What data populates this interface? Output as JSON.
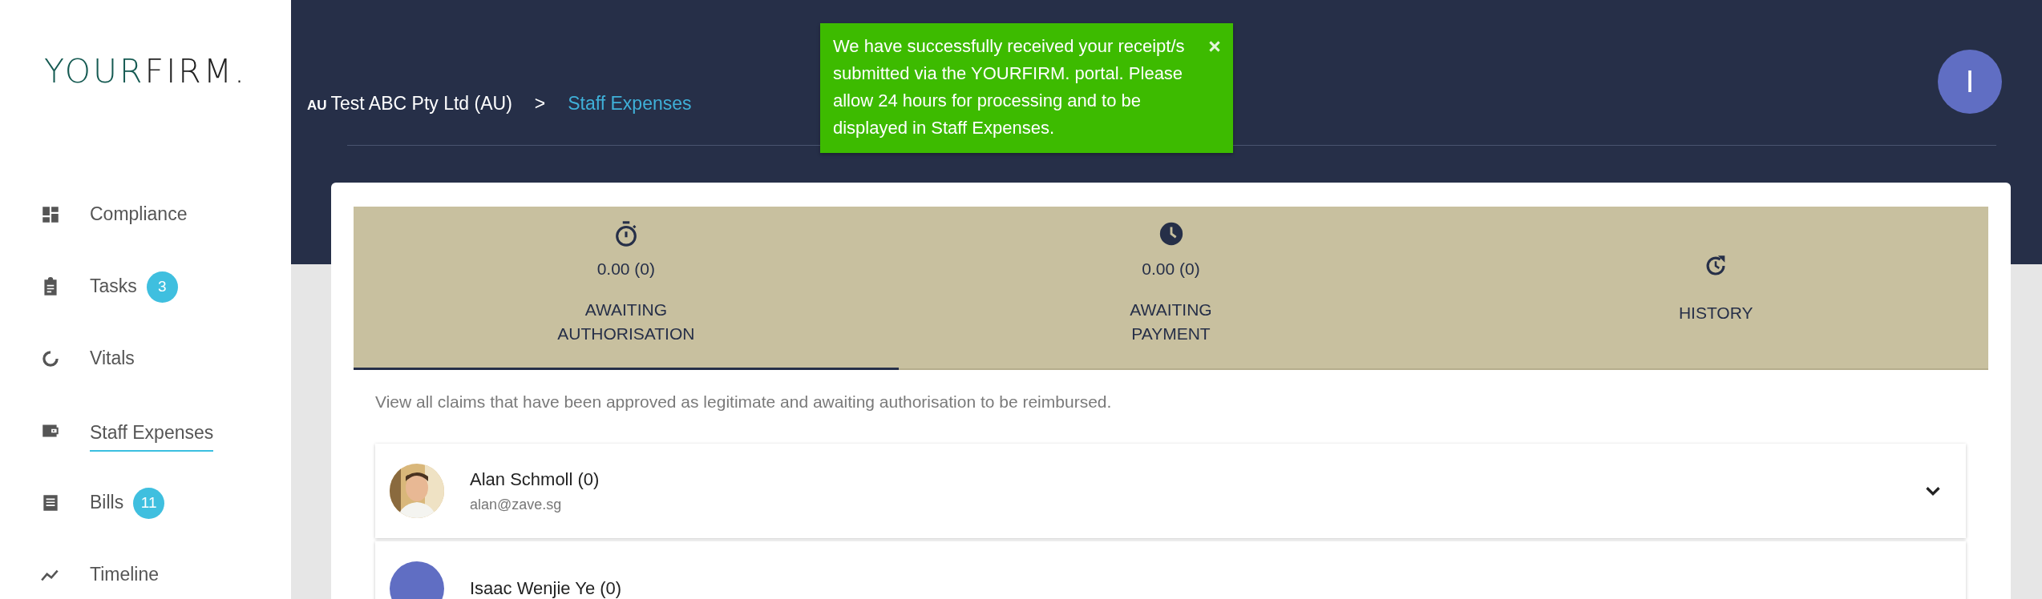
{
  "logo": {
    "first": "YOUR",
    "second": "FIRM."
  },
  "nav": [
    {
      "label": "Compliance",
      "selected": false
    },
    {
      "label": "Tasks",
      "badge": "3",
      "selected": false
    },
    {
      "label": "Vitals",
      "selected": false
    },
    {
      "label": "Staff Expenses",
      "selected": true
    },
    {
      "label": "Bills",
      "badge": "11",
      "selected": false
    },
    {
      "label": "Timeline",
      "selected": false
    }
  ],
  "breadcrumb": {
    "country": "AU",
    "company": "Test ABC Pty Ltd (AU)",
    "separator": ">",
    "current": "Staff Expenses"
  },
  "toast": {
    "message": "We have successfully received your receipt/s submitted via the YOURFIRM. portal. Please allow 24 hours for processing and to be displayed in Staff Expenses."
  },
  "user": {
    "initial": "I"
  },
  "tabs": [
    {
      "amount": "0.00 (0)",
      "label": "AWAITING AUTHORISATION",
      "selected": true
    },
    {
      "amount": "0.00 (0)",
      "label": "AWAITING PAYMENT",
      "selected": false
    },
    {
      "label": "HISTORY",
      "selected": false
    }
  ],
  "description": "View all claims that have been approved as legitimate and awaiting authorisation to be reimbursed.",
  "claimants": [
    {
      "name": "Alan Schmoll (0)",
      "email": "alan@zave.sg"
    },
    {
      "name": "Isaac Wenjie Ye (0)",
      "avatar": {
        "kind": "initial"
      }
    }
  ]
}
